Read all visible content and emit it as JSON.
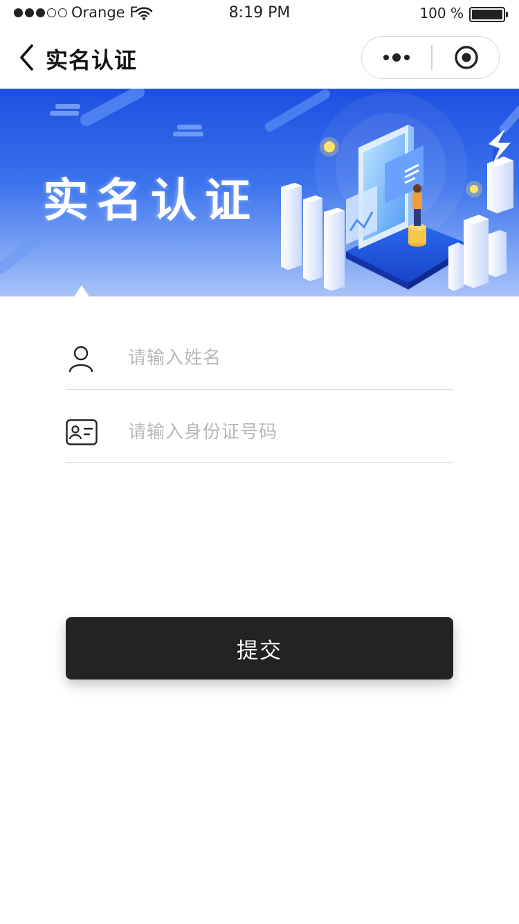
{
  "status_bar": {
    "carrier": "Orange F",
    "time": "8:19 PM",
    "battery_percent": "100 %",
    "signal_filled_bars": 3,
    "signal_total_bars": 5,
    "battery_level": 1.0
  },
  "nav": {
    "title": "实名认证",
    "back_icon": "chevron-left-icon",
    "more_icon": "more-dots-icon",
    "close_icon": "target-circle-icon"
  },
  "banner": {
    "title": "实名认证"
  },
  "form": {
    "name_field": {
      "placeholder": "请输入姓名",
      "value": "",
      "icon": "user-icon"
    },
    "id_field": {
      "placeholder": "请输入身份证号码",
      "value": "",
      "icon": "id-card-icon"
    }
  },
  "submit": {
    "label": "提交"
  },
  "colors": {
    "primary_button": "#232323",
    "banner_top": "#1d4fe0",
    "banner_bottom": "#a8c2f8",
    "placeholder": "#b8b8b8",
    "divider": "#dcdcdc"
  }
}
